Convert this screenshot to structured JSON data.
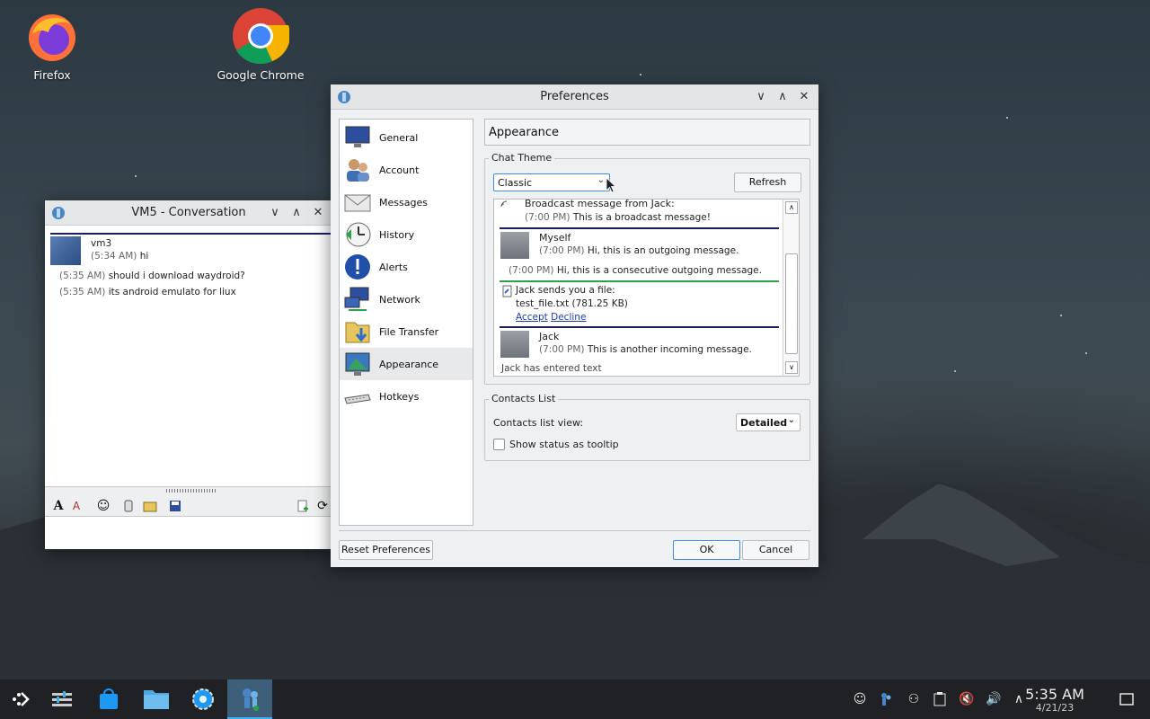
{
  "desktop": {
    "icons": [
      {
        "label": "Firefox"
      },
      {
        "label": "Google Chrome"
      }
    ]
  },
  "conversation": {
    "title": "VM5 - Conversation",
    "sender": "vm3",
    "messages": [
      {
        "time": "(5:34 AM)",
        "text": "hi"
      },
      {
        "time": "(5:35 AM)",
        "text": "should i download waydroid?"
      },
      {
        "time": "(5:35 AM)",
        "text": "its android emulato for liux"
      }
    ]
  },
  "prefs": {
    "title": "Preferences",
    "nav": [
      {
        "label": "General"
      },
      {
        "label": "Account"
      },
      {
        "label": "Messages"
      },
      {
        "label": "History"
      },
      {
        "label": "Alerts"
      },
      {
        "label": "Network"
      },
      {
        "label": "File Transfer"
      },
      {
        "label": "Appearance"
      },
      {
        "label": "Hotkeys"
      }
    ],
    "section_title": "Appearance",
    "chat_theme": {
      "legend": "Chat Theme",
      "selected": "Classic",
      "refresh": "Refresh",
      "preview": {
        "broadcast_header": "Broadcast message from Jack:",
        "broadcast_time": "(7:00 PM)",
        "broadcast_text": "This is a broadcast message!",
        "out_name": "Myself",
        "out_time": "(7:00 PM)",
        "out_text": "Hi, this is an outgoing message.",
        "consec_time": "(7:00 PM)",
        "consec_text": "Hi, this is a consecutive outgoing message.",
        "file_header": "Jack sends you a file:",
        "file_name": "test_file.txt (781.25 KB)",
        "accept": "Accept",
        "decline": "Decline",
        "in_name": "Jack",
        "in_time": "(7:00 PM)",
        "in_text": "This is another incoming message.",
        "typing": "Jack has entered text"
      }
    },
    "contacts": {
      "legend": "Contacts List",
      "view_label": "Contacts list view:",
      "view_value": "Detailed",
      "tooltip_label": "Show status as tooltip"
    },
    "buttons": {
      "reset": "Reset Preferences",
      "ok": "OK",
      "cancel": "Cancel"
    }
  },
  "taskbar": {
    "time": "5:35 AM",
    "date": "4/21/23"
  }
}
